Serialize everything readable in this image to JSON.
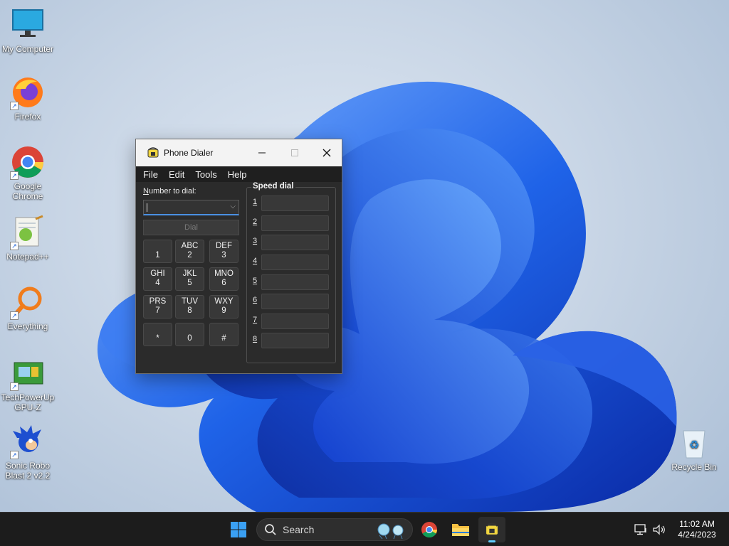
{
  "desktop": {
    "icons": [
      {
        "label": "My Computer",
        "icon": "monitor-icon"
      },
      {
        "label": "Firefox",
        "icon": "firefox-icon"
      },
      {
        "label": "Google Chrome",
        "icon": "chrome-icon"
      },
      {
        "label": "Notepad++",
        "icon": "notepadpp-icon"
      },
      {
        "label": "Everything",
        "icon": "everything-icon"
      },
      {
        "label": "TechPowerUp GPU-Z",
        "icon": "gpuz-icon"
      },
      {
        "label": "Sonic Robo Blast 2 v2.2",
        "icon": "sonic-icon"
      }
    ],
    "recycle_bin": {
      "label": "Recycle Bin",
      "icon": "recycle-bin-icon"
    }
  },
  "window": {
    "title": "Phone Dialer",
    "menu": [
      "File",
      "Edit",
      "Tools",
      "Help"
    ],
    "number_label_accel": "N",
    "number_label_rest": "umber to dial:",
    "number_value": "",
    "dial_label": "Dial",
    "keypad": [
      {
        "letters": "",
        "digit": "1"
      },
      {
        "letters": "ABC",
        "digit": "2"
      },
      {
        "letters": "DEF",
        "digit": "3"
      },
      {
        "letters": "GHI",
        "digit": "4"
      },
      {
        "letters": "JKL",
        "digit": "5"
      },
      {
        "letters": "MNO",
        "digit": "6"
      },
      {
        "letters": "PRS",
        "digit": "7"
      },
      {
        "letters": "TUV",
        "digit": "8"
      },
      {
        "letters": "WXY",
        "digit": "9"
      },
      {
        "letters": "",
        "digit": "*"
      },
      {
        "letters": "",
        "digit": "0"
      },
      {
        "letters": "",
        "digit": "#"
      }
    ],
    "speed_dial_title": "Speed dial",
    "speed_dial": [
      "1",
      "2",
      "3",
      "4",
      "5",
      "6",
      "7",
      "8"
    ]
  },
  "taskbar": {
    "search_label": "Search",
    "time": "11:02 AM",
    "date": "4/24/2023"
  },
  "colors": {
    "accent": "#4a90e2",
    "window_bg": "#2b2b2b",
    "taskbar_bg": "#1c1c1c"
  }
}
